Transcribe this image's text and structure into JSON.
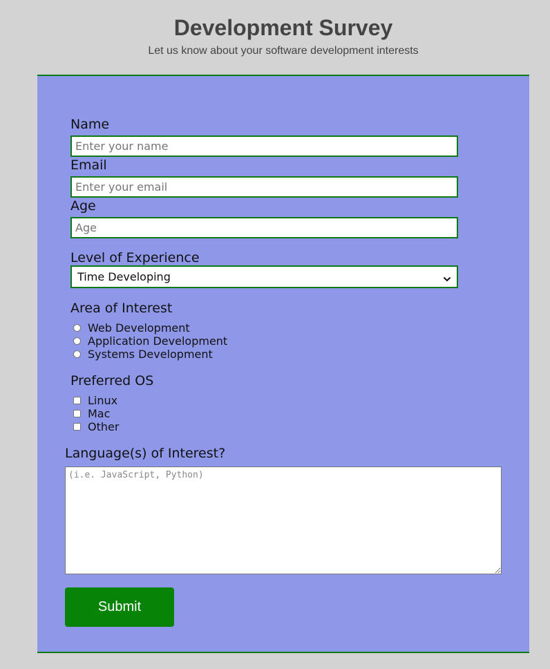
{
  "header": {
    "title": "Development Survey",
    "description": "Let us know about your software development interests"
  },
  "form": {
    "name": {
      "label": "Name",
      "placeholder": "Enter your name"
    },
    "email": {
      "label": "Email",
      "placeholder": "Enter your email"
    },
    "age": {
      "label": "Age",
      "placeholder": "Age"
    },
    "experience": {
      "label": "Level of Experience",
      "selected": "Time Developing"
    },
    "interest": {
      "label": "Area of Interest",
      "options": [
        "Web Development",
        "Application Development",
        "Systems Development"
      ]
    },
    "os": {
      "label": "Preferred OS",
      "options": [
        "Linux",
        "Mac",
        "Other"
      ]
    },
    "languages": {
      "label": "Language(s) of Interest?",
      "placeholder": "(i.e. JavaScript, Python)"
    },
    "submit_label": "Submit"
  },
  "colors": {
    "page_bg": "#d3d3d3",
    "panel_bg": "#8f98e8",
    "accent_green": "#0b7a13",
    "button_green": "#078307",
    "title_text": "#444444"
  },
  "icons": {
    "select_arrow": "chevron-down-icon"
  }
}
